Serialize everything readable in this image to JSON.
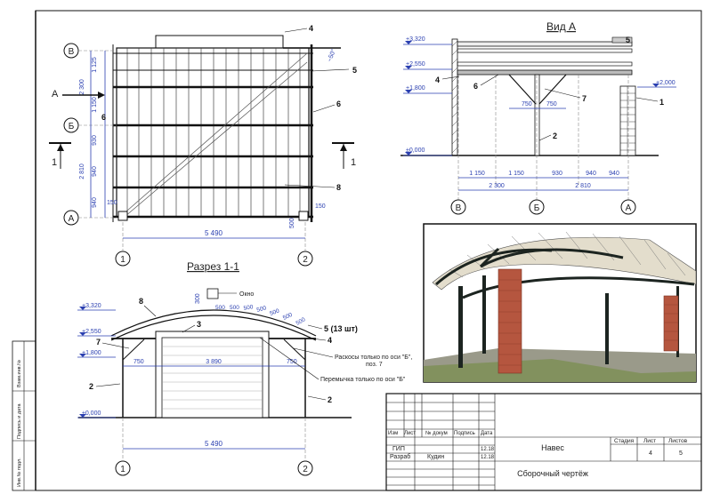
{
  "plan": {
    "grid_rows": [
      "В",
      "Б",
      "А"
    ],
    "grid_cols": [
      "1",
      "2"
    ],
    "section_mark_a": "А",
    "section_mark_1": "1",
    "callouts": [
      "4",
      "5",
      "6",
      "6",
      "8"
    ],
    "dim_left": [
      "1 125",
      "2 300",
      "1 150",
      "930",
      "2 810",
      "940",
      "940",
      "150"
    ],
    "dim_bottom": "5 490",
    "dim_small": [
      "150",
      "500",
      "~50°"
    ]
  },
  "view_a": {
    "title": "Вид А",
    "levels": [
      "+3,320",
      "+2,550",
      "+1,800",
      "±0,000"
    ],
    "level_right": "+2,000",
    "callouts": [
      "5",
      "4",
      "6",
      "7",
      "1",
      "2"
    ],
    "dims_braces": [
      "750",
      "750"
    ],
    "dims_row1": [
      "1 150",
      "1 150",
      "930",
      "940",
      "940"
    ],
    "dims_row2": [
      "2 300",
      "2 810"
    ],
    "axes": [
      "В",
      "Б",
      "А"
    ]
  },
  "section": {
    "title": "Разрез 1-1",
    "levels": [
      "+3,320",
      "+2,550",
      "+1,800",
      "±0,000"
    ],
    "callouts": [
      "8",
      "3",
      "7",
      "4",
      "2",
      "2"
    ],
    "callout_5": "5 (13 шт)",
    "window_label": "Окно",
    "window_dim": "300",
    "arc_dims": [
      "500",
      "500",
      "500",
      "500",
      "500",
      "500",
      "500"
    ],
    "dims": [
      "750",
      "3 890",
      "750"
    ],
    "total": "5 490",
    "axes": [
      "1",
      "2"
    ],
    "note1": "Раскосы только по оси \"Б\",",
    "note1b": "поз. 7",
    "note2": "Перемычка только по оси \"Б\""
  },
  "side_stamp": [
    "Взам.инв.№",
    "Подпись и дата",
    "Инв.№ подл."
  ],
  "title_block": {
    "headers": [
      "Изм",
      "Лист",
      "№ докум",
      "Подпись",
      "Дата"
    ],
    "rows": [
      {
        "role": "ГИП",
        "name": "",
        "date": "12.18"
      },
      {
        "role": "Разраб",
        "name": "Кудин",
        "date": "12.18"
      }
    ],
    "project": "Навес",
    "sheet_title": "Сборочный чертёж",
    "stage_label": "Стадия",
    "sheet_label": "Лист",
    "sheets_label": "Листов",
    "stage": "",
    "sheet": "4",
    "sheets": "5"
  },
  "colors": {
    "dimension": "#2a3fb0",
    "roof": "#dcd6c6",
    "brick": "#b5563f",
    "steel": "#1c2420",
    "sky": "#ffffff",
    "ground": "#9a9a8a",
    "grass": "#6f8a3a"
  }
}
